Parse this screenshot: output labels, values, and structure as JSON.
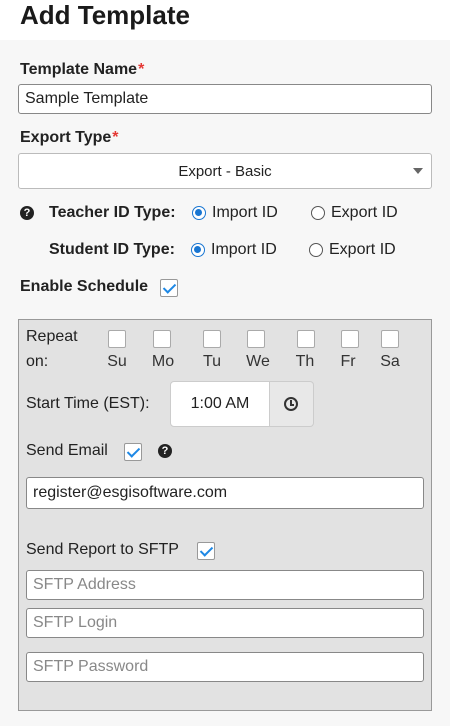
{
  "page": {
    "title": "Add Template"
  },
  "template_name": {
    "label": "Template Name",
    "required_mark": "*",
    "value": "Sample Template"
  },
  "export_type": {
    "label": "Export Type",
    "required_mark": "*",
    "selected": "Export - Basic"
  },
  "teacher_id": {
    "label": "Teacher ID Type:",
    "option_import": "Import ID",
    "option_export": "Export ID",
    "selected": "Import ID"
  },
  "student_id": {
    "label": "Student ID Type:",
    "option_import": "Import ID",
    "option_export": "Export ID",
    "selected": "Import ID"
  },
  "enable_schedule": {
    "label": "Enable Schedule",
    "checked": true
  },
  "schedule": {
    "repeat_label_1": "Repeat",
    "repeat_label_2": "on:",
    "days": [
      "Su",
      "Mo",
      "Tu",
      "We",
      "Th",
      "Fr",
      "Sa"
    ],
    "start_time_label": "Start Time (EST):",
    "start_time_value": "1:00 AM",
    "send_email_label": "Send Email",
    "send_email_checked": true,
    "email_value": "register@esgisoftware.com",
    "sftp_label": "Send Report to SFTP",
    "sftp_checked": true,
    "sftp_address_placeholder": "SFTP Address",
    "sftp_login_placeholder": "SFTP Login",
    "sftp_password_placeholder": "SFTP Password"
  },
  "icons": {
    "help": "question-circle-icon",
    "clock": "clock-icon",
    "caret": "caret-down-icon"
  },
  "colors": {
    "accent": "#1976d2",
    "required": "#e53935",
    "check": "#1e88e5"
  }
}
